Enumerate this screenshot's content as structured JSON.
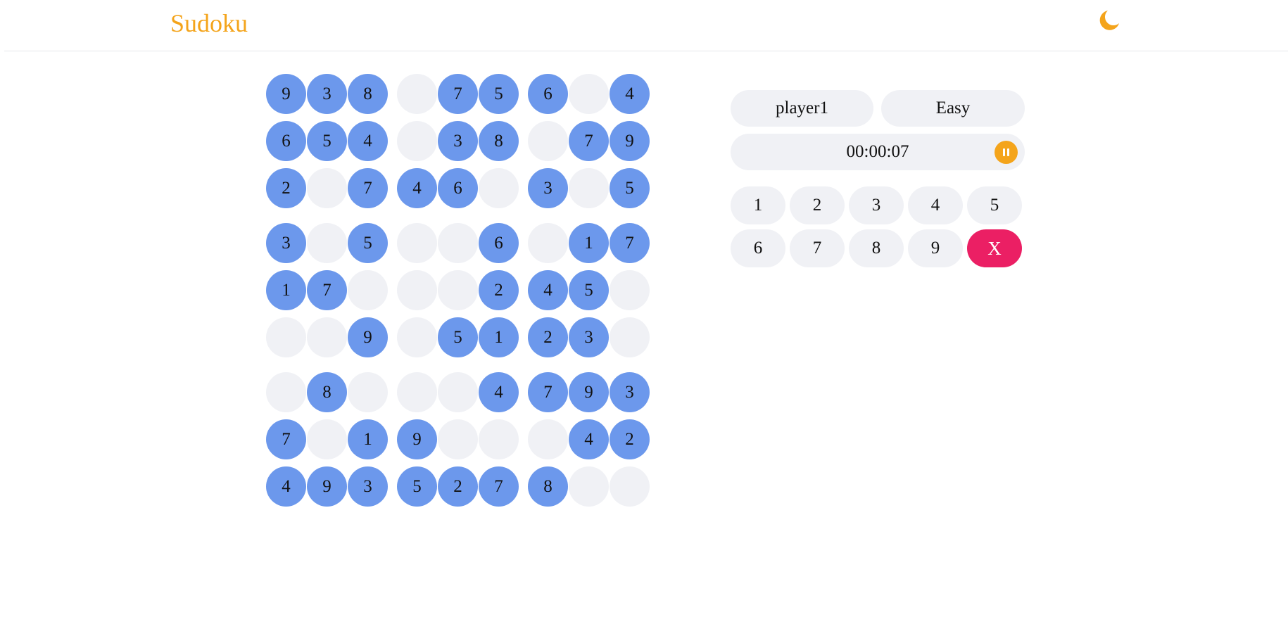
{
  "header": {
    "title": "Sudoku",
    "theme_icon": "moon-icon",
    "accent_color": "#f4a41b"
  },
  "board": {
    "filled_color": "#6c98ec",
    "empty_color": "#f0f1f5",
    "rows": [
      [
        "9",
        "3",
        "8",
        "",
        "7",
        "5",
        "6",
        "",
        "4"
      ],
      [
        "6",
        "5",
        "4",
        "",
        "3",
        "8",
        "",
        "7",
        "9"
      ],
      [
        "2",
        "",
        "7",
        "4",
        "6",
        "",
        "3",
        "",
        "5"
      ],
      [
        "3",
        "",
        "5",
        "",
        "",
        "6",
        "",
        "1",
        "7"
      ],
      [
        "1",
        "7",
        "",
        "",
        "",
        "2",
        "4",
        "5",
        ""
      ],
      [
        "",
        "",
        "9",
        "",
        "5",
        "1",
        "2",
        "3",
        ""
      ],
      [
        "",
        "8",
        "",
        "",
        "",
        "4",
        "7",
        "9",
        "3"
      ],
      [
        "7",
        "",
        "1",
        "9",
        "",
        "",
        "",
        "4",
        "2"
      ],
      [
        "4",
        "9",
        "3",
        "5",
        "2",
        "7",
        "8",
        "",
        ""
      ]
    ]
  },
  "panel": {
    "player": "player1",
    "level": "Easy",
    "timer": "00:00:07",
    "pause_icon": "pause-icon",
    "numpad": [
      "1",
      "2",
      "3",
      "4",
      "5",
      "6",
      "7",
      "8",
      "9"
    ],
    "erase_label": "X",
    "erase_color": "#eb1f64"
  }
}
